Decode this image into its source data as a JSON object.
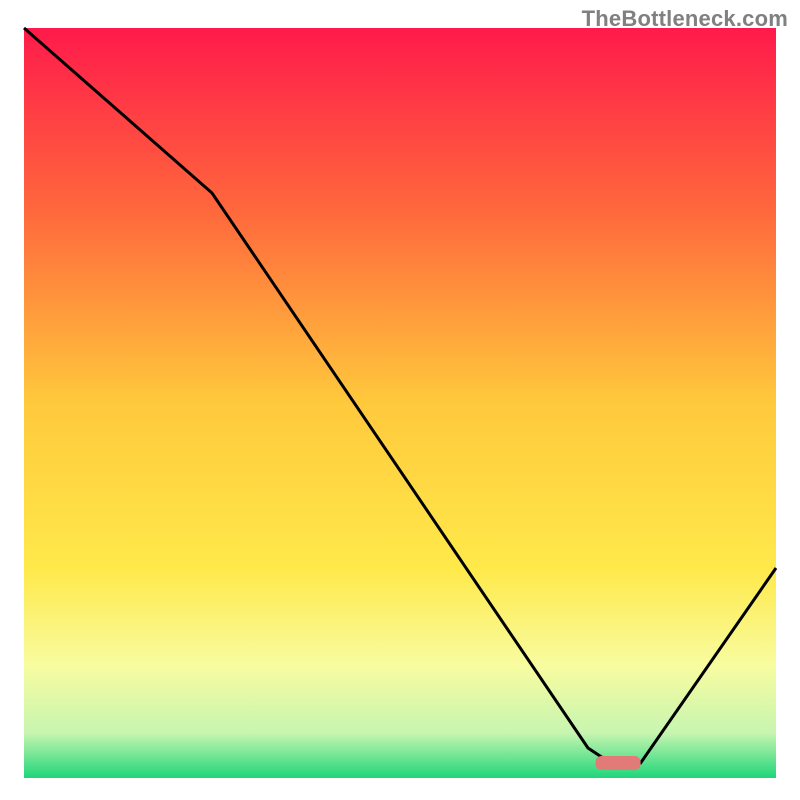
{
  "watermark": "TheBottleneck.com",
  "chart_data": {
    "type": "line",
    "title": "",
    "xlabel": "",
    "ylabel": "",
    "xlim": [
      0,
      100
    ],
    "ylim": [
      0,
      100
    ],
    "x": [
      0,
      25,
      75,
      78,
      82,
      100
    ],
    "values": [
      100,
      78,
      4,
      2,
      2,
      28
    ],
    "marker": {
      "x_start": 76,
      "x_end": 82,
      "y": 2,
      "color": "#e27b78"
    },
    "background_gradient": {
      "stops": [
        {
          "pos": 0.0,
          "color": "#ff1a4b"
        },
        {
          "pos": 0.25,
          "color": "#ff6a3c"
        },
        {
          "pos": 0.5,
          "color": "#ffc93c"
        },
        {
          "pos": 0.72,
          "color": "#ffe94a"
        },
        {
          "pos": 0.85,
          "color": "#f8fca0"
        },
        {
          "pos": 0.94,
          "color": "#c7f5b0"
        },
        {
          "pos": 1.0,
          "color": "#1fd67a"
        }
      ]
    },
    "line_color": "#000000",
    "line_width": 3
  }
}
